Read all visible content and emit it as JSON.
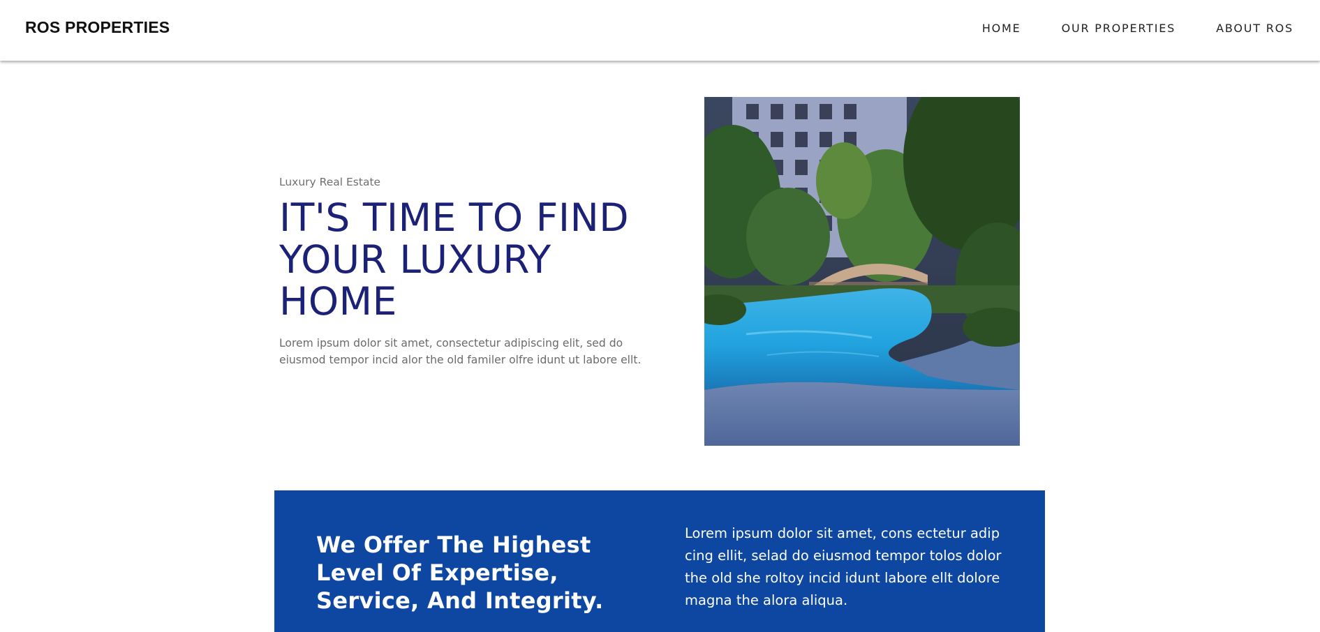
{
  "header": {
    "brand": "ROS PROPERTIES",
    "nav": [
      "HOME",
      "OUR PROPERTIES",
      "ABOUT ROS"
    ]
  },
  "hero": {
    "kicker": "Luxury Real Estate",
    "headline_lines": [
      "IT'S TIME TO FIND",
      "YOUR LUXURY",
      "HOME"
    ],
    "body": "Lorem ipsum dolor sit amet, consectetur adipiscing elit, sed do eiusmod tempor incid alor the old familer olfre idunt ut labore ellt.",
    "image_alt": "apartment-pool-photo"
  },
  "band": {
    "heading_lines": [
      "We Offer The Highest",
      "Level Of Expertise,",
      "Service, And Integrity."
    ],
    "body": "Lorem ipsum dolor sit amet, cons ectetur adip cing ellit, selad do eiusmod tempor tolos dolor the old she roltoy incid idunt labore ellt dolore magna the alora aliqua."
  },
  "colors": {
    "headline": "#1c2178",
    "band_background": "#0d47a1",
    "text_muted": "#6b6b6b"
  }
}
